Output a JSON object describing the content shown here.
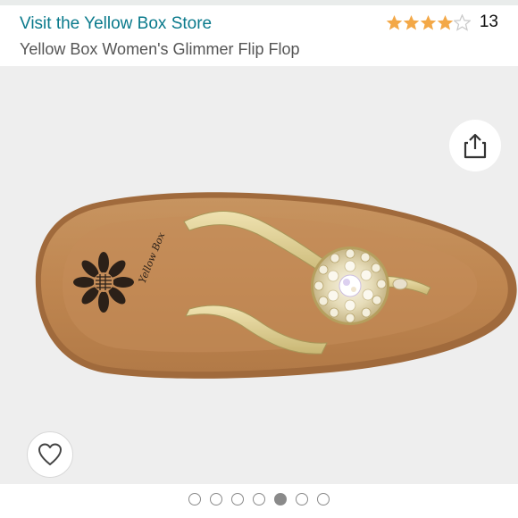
{
  "store_link": "Visit the Yellow Box Store",
  "rating": {
    "stars": 4,
    "max_stars": 5,
    "count": "13"
  },
  "product_title": "Yellow Box Women's Glimmer Flip Flop",
  "image": {
    "brand_script": "Yellow Box",
    "colors": {
      "background": "#eeeeee",
      "sole": "#c48a57",
      "strap": "#d8c98a"
    }
  },
  "carousel": {
    "total": 7,
    "active_index": 4
  },
  "icons": {
    "share": "share-icon",
    "wishlist": "heart-icon"
  }
}
